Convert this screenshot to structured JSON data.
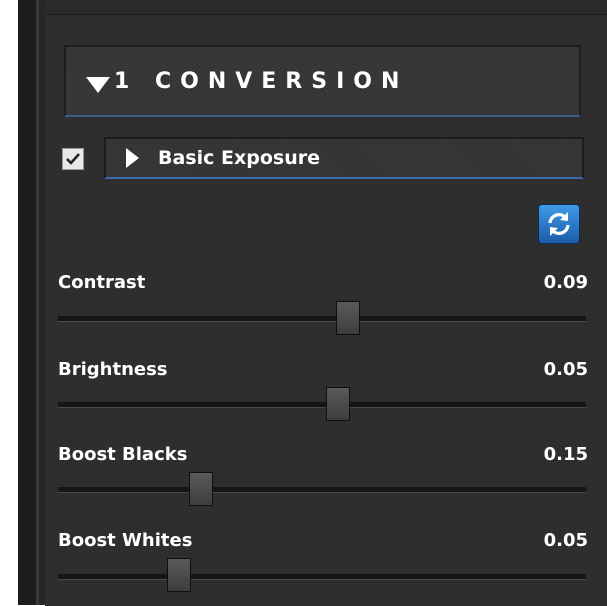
{
  "section": {
    "title": "1 CONVERSION"
  },
  "subsection": {
    "label": "Basic Exposure",
    "enabled": true
  },
  "sliders": [
    {
      "label": "Contrast",
      "value": "0.09",
      "position": 0.55
    },
    {
      "label": "Brightness",
      "value": "0.05",
      "position": 0.53
    },
    {
      "label": "Boost Blacks",
      "value": "0.15",
      "position": 0.27
    },
    {
      "label": "Boost Whites",
      "value": "0.05",
      "position": 0.23
    }
  ],
  "colors": {
    "accent": "#3a6ea8",
    "panel": "#2e2e2e",
    "reset_button": "#2f7fd0"
  },
  "icons": {
    "reset": "refresh-arrows-icon",
    "checkbox": "checkmark-icon"
  }
}
